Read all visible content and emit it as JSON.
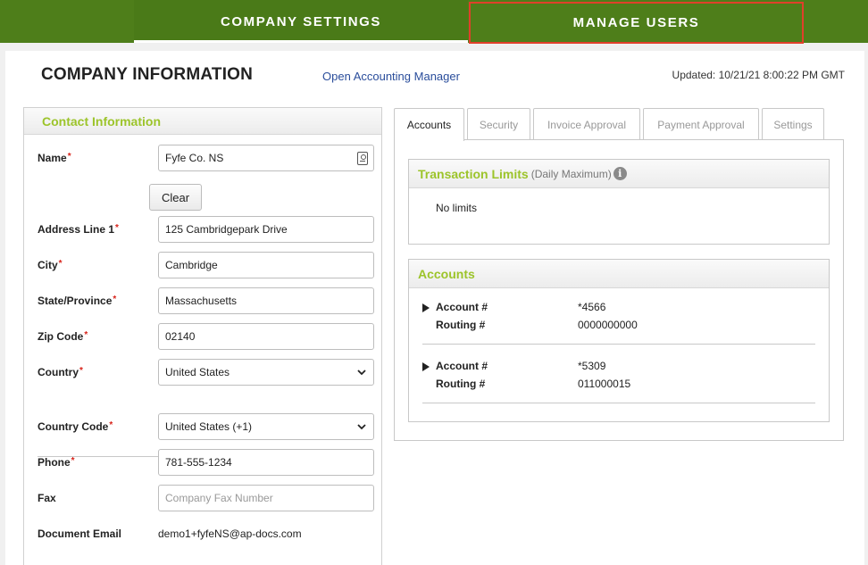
{
  "nav": {
    "company_settings": "COMPANY SETTINGS",
    "manage_users": "MANAGE USERS"
  },
  "header": {
    "title": "COMPANY INFORMATION",
    "accounting_link": "Open Accounting Manager",
    "updated": "Updated: 10/21/21 8:00:22 PM GMT"
  },
  "contact": {
    "heading": "Contact Information",
    "required_mark": "*",
    "name_label": "Name",
    "name_value": "Fyfe Co. NS",
    "clear_label": "Clear",
    "address_label": "Address Line 1",
    "address_value": "125 Cambridgepark Drive",
    "city_label": "City",
    "city_value": "Cambridge",
    "state_label": "State/Province",
    "state_value": "Massachusetts",
    "zip_label": "Zip Code",
    "zip_value": "02140",
    "country_label": "Country",
    "country_value": "United States",
    "country_code_label": "Country Code",
    "country_code_value": "United States (+1)",
    "phone_label": "Phone",
    "phone_value": "781-555-1234",
    "fax_label": "Fax",
    "fax_placeholder": "Company Fax Number",
    "doc_email_label": "Document Email",
    "doc_email_value": "demo1+fyfeNS@ap-docs.com"
  },
  "tabs": [
    "Accounts",
    "Security",
    "Invoice Approval",
    "Payment Approval",
    "Settings"
  ],
  "limits": {
    "title": "Transaction Limits",
    "subtitle": "(Daily Maximum)",
    "info_glyph": "i",
    "value": "No limits"
  },
  "accounts": {
    "title": "Accounts",
    "account_label": "Account #",
    "routing_label": "Routing #",
    "items": [
      {
        "account": "*4566",
        "routing": "0000000000"
      },
      {
        "account": "*5309",
        "routing": "011000015"
      }
    ]
  },
  "colors": {
    "nav_green": "#4e7e1a",
    "accent_green": "#9cc42a",
    "highlight_border": "#e0402a",
    "required_red": "#d8231a",
    "link_blue": "#2a4d9b"
  }
}
